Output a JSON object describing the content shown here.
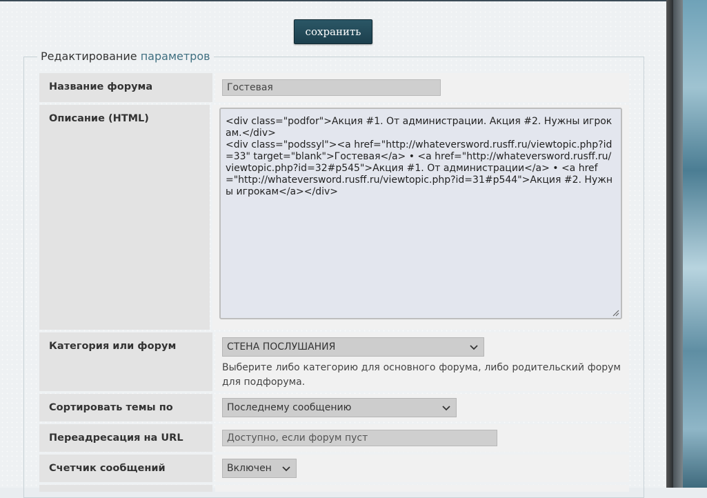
{
  "toolbar": {
    "save_label": "сохранить"
  },
  "legend": {
    "part1": "Редактирование",
    "part2": " параметров"
  },
  "fields": {
    "forum_name": {
      "label": "Название форума",
      "value": "Гостевая"
    },
    "description": {
      "label": "Описание (HTML)",
      "value": "<div class=\"podfor\">Акция #1. От администрации. Акция #2. Нужны игрокам.</div>\n<div class=\"podssyl\"><a href=\"http://whateversword.rusff.ru/viewtopic.php?id=33\" target=\"blank\">Гостевая</a> • <a href=\"http://whateversword.rusff.ru/viewtopic.php?id=32#p545\">Акция #1. От администрации</a> • <a href=\"http://whateversword.rusff.ru/viewtopic.php?id=31#p544\">Акция #2. Нужны игрокам</a></div>"
    },
    "category": {
      "label": "Категория или форум",
      "selected": "СТЕНА ПОСЛУШАНИЯ",
      "hint": "Выберите либо категорию для основного форума, либо родительский форум для подфорума."
    },
    "sort": {
      "label": "Сортировать темы по",
      "selected": "Последнему сообщению"
    },
    "redirect": {
      "label": "Переадресация на URL",
      "placeholder": "Доступно, если форум пуст"
    },
    "post_counter": {
      "label": "Счетчик сообщений",
      "selected": "Включен"
    }
  },
  "icons": {
    "select_arrow": "chevron-down-icon",
    "resize_handle": "resize-handle-icon"
  },
  "colors": {
    "button": "#1c3f4d",
    "label_bg": "#e3e3e3",
    "textarea_bg": "#e3e6ee"
  }
}
